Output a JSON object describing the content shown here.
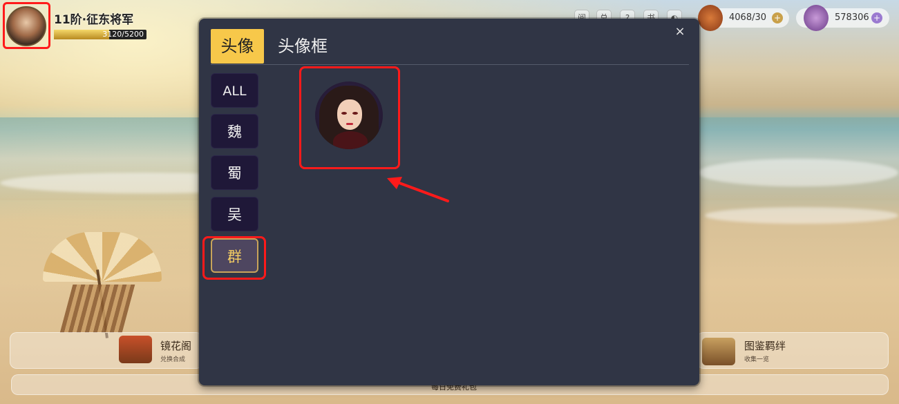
{
  "player": {
    "rank_title": "11阶·征东将军",
    "xp_text": "3120/5200",
    "xp_fraction": 0.6
  },
  "resources": [
    {
      "name": "bag",
      "value": "4068/30",
      "color": "#b8562a"
    },
    {
      "name": "coin-pouch",
      "value": "578306",
      "color": "#9a6ab0"
    }
  ],
  "top_icons": [
    "阅",
    "总",
    "?",
    "书",
    "◐"
  ],
  "bottom_features": {
    "left": {
      "title": "镜花阁",
      "subtitle": "兑换合成"
    },
    "right": {
      "title": "图鉴羁绊",
      "subtitle": "收集一览"
    },
    "strip": "每日免费礼包"
  },
  "modal": {
    "close_label": "×",
    "tabs": [
      {
        "label": "头像",
        "active": true
      },
      {
        "label": "头像框",
        "active": false
      }
    ],
    "factions": [
      {
        "label": "ALL",
        "selected": false
      },
      {
        "label": "魏",
        "selected": false
      },
      {
        "label": "蜀",
        "selected": false
      },
      {
        "label": "吴",
        "selected": false
      },
      {
        "label": "群",
        "selected": true
      }
    ]
  },
  "colors": {
    "highlight": "#ff1a1a",
    "tab_active": "#f7c84a",
    "faction_selected_text": "#f2cb63"
  }
}
